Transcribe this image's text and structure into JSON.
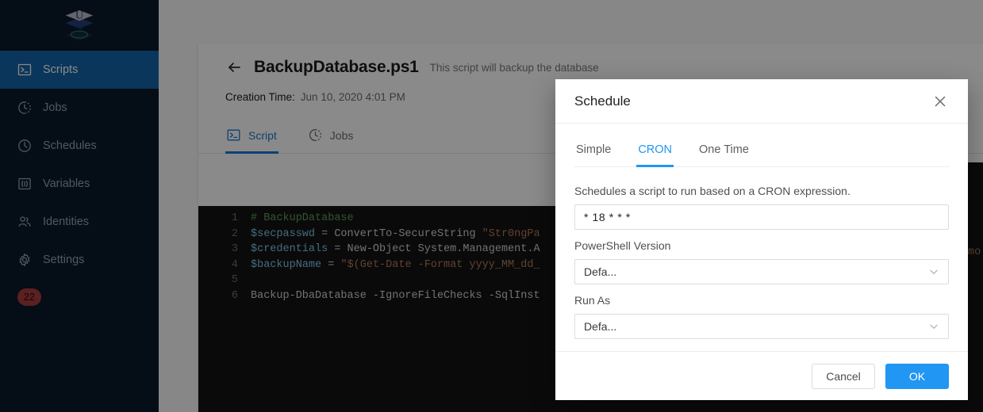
{
  "sidebar": {
    "logo_name": "powershell-universal-logo",
    "items": [
      {
        "label": "Scripts",
        "icon": "terminal-icon",
        "active": true
      },
      {
        "label": "Jobs",
        "icon": "clock-half-icon",
        "active": false
      },
      {
        "label": "Schedules",
        "icon": "clock-icon",
        "active": false
      },
      {
        "label": "Variables",
        "icon": "variable-icon",
        "active": false
      },
      {
        "label": "Identities",
        "icon": "people-icon",
        "active": false
      },
      {
        "label": "Settings",
        "icon": "gear-icon",
        "active": false
      }
    ],
    "badge": "22",
    "badge_color": "#a93b3b",
    "background": "#0a1929",
    "active_background": "#1565a8"
  },
  "page": {
    "back_label": "back-arrow",
    "script_title": "BackupDatabase.ps1",
    "script_description": "This script will backup the database",
    "creation_time_label": "Creation Time:",
    "creation_time_value": "Jun 10, 2020 4:01 PM",
    "tabs": [
      {
        "label": "Script",
        "icon": "terminal-icon",
        "active": true
      },
      {
        "label": "Jobs",
        "icon": "clock-half-icon",
        "active": false
      }
    ]
  },
  "editor": {
    "language": "powershell",
    "background": "#141414",
    "lines": [
      {
        "n": "1",
        "tokens": [
          {
            "t": "# BackupDatabase",
            "c": "c-comment"
          }
        ]
      },
      {
        "n": "2",
        "tokens": [
          {
            "t": "$secpasswd",
            "c": "c-var"
          },
          {
            "t": " = ConvertTo-SecureString ",
            "c": "ctext"
          },
          {
            "t": "\"Str0ngPa",
            "c": "c-str"
          }
        ]
      },
      {
        "n": "3",
        "tokens": [
          {
            "t": "$credentials",
            "c": "c-var"
          },
          {
            "t": " = New-Object System.Management.A",
            "c": "ctext"
          }
        ]
      },
      {
        "n": "4",
        "tokens": [
          {
            "t": "$backupName",
            "c": "c-var"
          },
          {
            "t": " = ",
            "c": "ctext"
          },
          {
            "t": "\"$(Get-Date -Format yyyy_MM_dd_",
            "c": "c-str"
          }
        ]
      },
      {
        "n": "5",
        "tokens": [
          {
            "t": "",
            "c": "ctext"
          }
        ]
      },
      {
        "n": "6",
        "tokens": [
          {
            "t": "Backup-DbaDatabase -IgnoreFileChecks -SqlInst",
            "c": "ctext"
          }
        ]
      }
    ],
    "right_sliver_text": "mo"
  },
  "modal": {
    "title": "Schedule",
    "close_icon": "close-icon",
    "tabs": [
      {
        "label": "Simple",
        "active": false
      },
      {
        "label": "CRON",
        "active": true
      },
      {
        "label": "One Time",
        "active": false
      }
    ],
    "description": "Schedules a script to run based on a CRON expression.",
    "cron": {
      "value": "* 18 * * *",
      "placeholder": "* * * * *"
    },
    "powershell_version": {
      "label": "PowerShell Version",
      "value": "Defa...",
      "chevron": "chevron-down-icon"
    },
    "run_as": {
      "label": "Run As",
      "value": "Defa...",
      "chevron": "chevron-down-icon"
    },
    "cancel_label": "Cancel",
    "ok_label": "OK",
    "accent_color": "#2196f3"
  }
}
